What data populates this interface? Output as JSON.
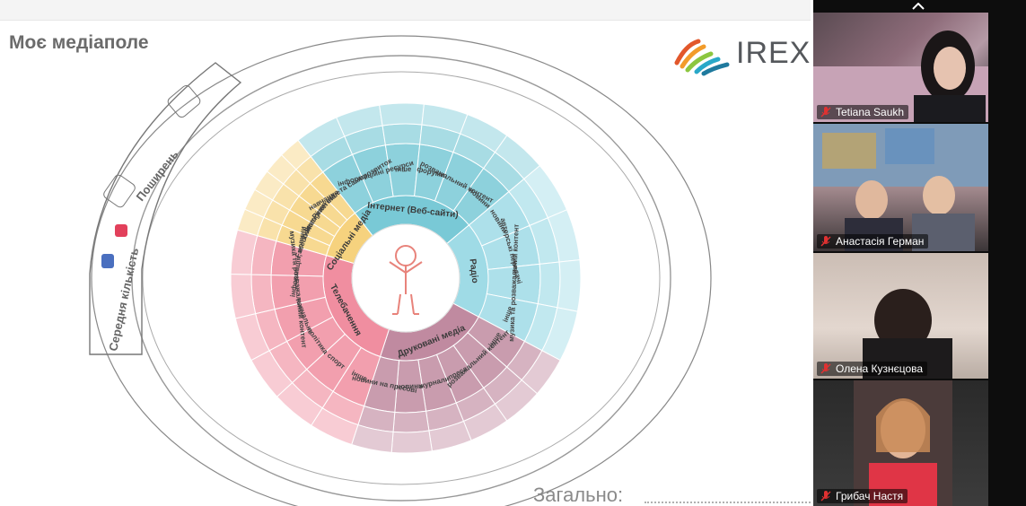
{
  "slide": {
    "title": "Моє медіаполе",
    "logo_text": "IREX",
    "bottom_label": "Загально:",
    "side_labels": {
      "average": "Середня кількість",
      "spread": "Поширень"
    },
    "center_icon": "stick-figure-person-icon",
    "sectors": [
      {
        "name": "Інтернет (Веб-сайти)",
        "color": "#79c9d6",
        "items": [
          "навчання та саморозвиток",
          "інформаційні ресурси",
          "інше",
          "форуми",
          "розважальний контент",
          "новини"
        ]
      },
      {
        "name": "Радіо",
        "color": "#9fdbe6",
        "items": [
          "новини",
          "авторські передачі",
          "музика та розважальний контент",
          "інше"
        ]
      },
      {
        "name": "Друковані медіа",
        "color": "#c08aa0",
        "items": [
          "інше",
          "розважальний контент",
          "преса",
          "журнали",
          "новини",
          "новини на пресові"
        ]
      },
      {
        "name": "Телебачення",
        "color": "#f08ea0",
        "items": [
          "інше",
          "спорт",
          "політика",
          "навчальне",
          "музика та розважальний контент",
          "інформація, новини"
        ]
      },
      {
        "name": "Соціальні медіа",
        "color": "#f6d27e",
        "items": [
          "Facebook",
          "Twitter",
          "Instagram",
          "Pinterest",
          "інше"
        ]
      }
    ]
  },
  "meeting": {
    "participants": [
      {
        "name": "Tetiana Saukh",
        "mic": "muted-mic-icon"
      },
      {
        "name": "Анастасія Герман",
        "mic": "muted-mic-icon"
      },
      {
        "name": "Олена Кузнєцова",
        "mic": "muted-mic-icon"
      },
      {
        "name": "Грибач Настя",
        "mic": "muted-mic-icon"
      }
    ],
    "collapse_icon": "chevron-up-icon"
  }
}
